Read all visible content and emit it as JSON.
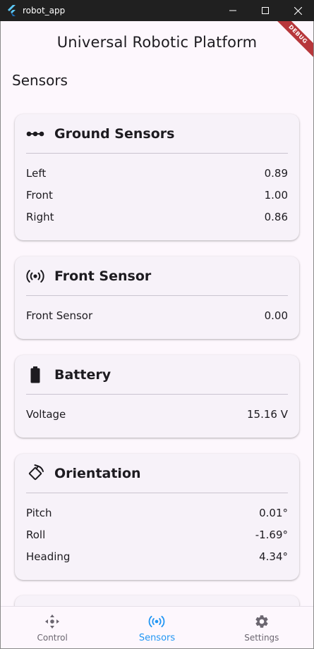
{
  "window": {
    "title": "robot_app"
  },
  "appbar": {
    "title": "Universal Robotic Platform",
    "debug_label": "DEBUG"
  },
  "page": {
    "section_title": "Sensors"
  },
  "cards": [
    {
      "title": "Ground Sensors",
      "icon": "dots-horizontal-icon",
      "rows": [
        {
          "label": "Left",
          "value": "0.89"
        },
        {
          "label": "Front",
          "value": "1.00"
        },
        {
          "label": "Right",
          "value": "0.86"
        }
      ]
    },
    {
      "title": "Front Sensor",
      "icon": "sensors-icon",
      "rows": [
        {
          "label": "Front Sensor",
          "value": "0.00"
        }
      ]
    },
    {
      "title": "Battery",
      "icon": "battery-icon",
      "rows": [
        {
          "label": "Voltage",
          "value": "15.16 V"
        }
      ]
    },
    {
      "title": "Orientation",
      "icon": "rotate-icon",
      "rows": [
        {
          "label": "Pitch",
          "value": "0.01°"
        },
        {
          "label": "Roll",
          "value": "-1.69°"
        },
        {
          "label": "Heading",
          "value": "4.34°"
        }
      ]
    }
  ],
  "bottom_nav": {
    "items": [
      {
        "label": "Control",
        "icon": "move-control-icon",
        "active": false
      },
      {
        "label": "Sensors",
        "icon": "sensors-icon",
        "active": true
      },
      {
        "label": "Settings",
        "icon": "gear-icon",
        "active": false
      }
    ]
  },
  "colors": {
    "accent": "#2196f3",
    "background": "#fdf7fd",
    "card": "#f7f2f9",
    "titlebar": "#202020",
    "debug_ribbon": "#b7373b"
  }
}
